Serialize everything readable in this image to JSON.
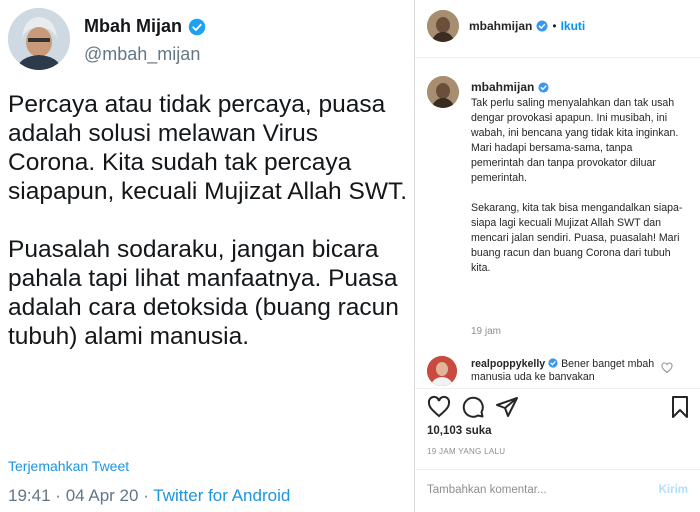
{
  "twitter": {
    "display_name": "Mbah Mijan",
    "handle": "@mbah_mijan",
    "tweet_text": "Percaya atau tidak percaya, puasa adalah solusi melawan Virus Corona. Kita sudah tak percaya siapapun, kecuali Mujizat Allah SWT.\n\nPuasalah sodaraku, jangan bicara pahala tapi lihat manfaatnya. Puasa adalah cara detoksida (buang racun tubuh) alami manusia.",
    "translate_label": "Terjemahkan Tweet",
    "time": "19:41",
    "date": "04 Apr 20",
    "separator": "·",
    "source": "Twitter for Android",
    "verified_color": "#1da1f2"
  },
  "instagram": {
    "username": "mbahmijan",
    "dot": "•",
    "follow_label": "Ikuti",
    "caption": "Tak perlu saling menyalahkan dan tak usah dengar provokasi apapun. Ini musibah, ini wabah, ini bencana yang tidak kita inginkan. Mari hadapi bersama-sama, tanpa pemerintah dan tanpa provokator diluar pemerintah.\n\nSekarang, kita tak bisa mengandalkan siapa-siapa lagi kecuali Mujizat Allah SWT dan mencari jalan sendiri. Puasa, puasalah! Mari buang racun dan buang Corona dari tubuh kita.",
    "caption_time": "19 jam",
    "comment_user": "realpoppykelly",
    "comment_text": "Bener banget mbah manusia uda ke banyakan",
    "likes": "10,103 suka",
    "time_ago": "19 JAM YANG LALU",
    "comment_placeholder": "Tambahkan komentar...",
    "send_label": "Kirim",
    "accent_color": "#0095f6"
  }
}
